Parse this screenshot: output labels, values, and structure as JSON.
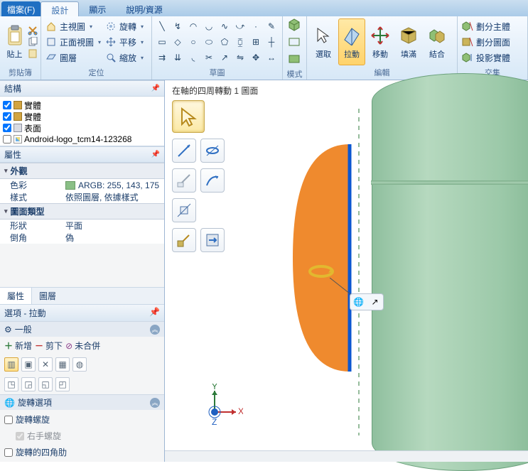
{
  "tabs": {
    "file": "檔案(F)",
    "design": "設計",
    "view": "顯示",
    "help": "說明/資源"
  },
  "ribbon": {
    "clipboard": {
      "label": "剪貼簿",
      "paste": "貼上"
    },
    "orient": {
      "label": "定位",
      "home_view": "主視圖",
      "front_view": "正面視圖",
      "plane_view": "圖層",
      "rotate": "旋轉",
      "pan": "平移",
      "zoom": "縮放"
    },
    "sketch": {
      "label": "草圖"
    },
    "mode": {
      "label": "模式"
    },
    "edit": {
      "label": "編輯",
      "select": "選取",
      "pull": "拉動",
      "move": "移動",
      "fill": "填滿",
      "combine": "結合"
    },
    "intersect": {
      "label": "交集",
      "split_body": "劃分主體",
      "split_face": "劃分圖面",
      "project": "投影實體"
    }
  },
  "panels": {
    "structure": "結構",
    "properties": "屬性",
    "tabs": {
      "props": "屬性",
      "layers": "圖層"
    },
    "options": "選項 - 拉動"
  },
  "tree": {
    "items": [
      {
        "label": "實體",
        "checked": true,
        "sw": "sw-gold"
      },
      {
        "label": "實體",
        "checked": true,
        "sw": "sw-gold"
      },
      {
        "label": "表面",
        "checked": true,
        "sw": "sw-face"
      },
      {
        "label": "Android-logo_tcm14-123268",
        "checked": false,
        "sw": "sw-img"
      }
    ]
  },
  "props": {
    "appearance": "外觀",
    "color_k": "色彩",
    "color_v": "ARGB: 255, 143, 175",
    "style_k": "樣式",
    "style_v": "依照圖層, 依據樣式",
    "facetype": "圖面類型",
    "shape_k": "形狀",
    "shape_v": "平面",
    "chamfer_k": "倒角",
    "chamfer_v": "偽"
  },
  "opts": {
    "general": "一般",
    "add": "新增",
    "cut": "剪下",
    "nomerge": "未合併",
    "rotopts": "旋轉選項",
    "helix": "旋轉螺旋",
    "rh": "右手螺旋",
    "corners": "旋轉的四角肋"
  },
  "viewport": {
    "status": "在軸的四周轉動 1 圖面",
    "axes": {
      "x": "X",
      "y": "Y",
      "z": "Z"
    }
  }
}
